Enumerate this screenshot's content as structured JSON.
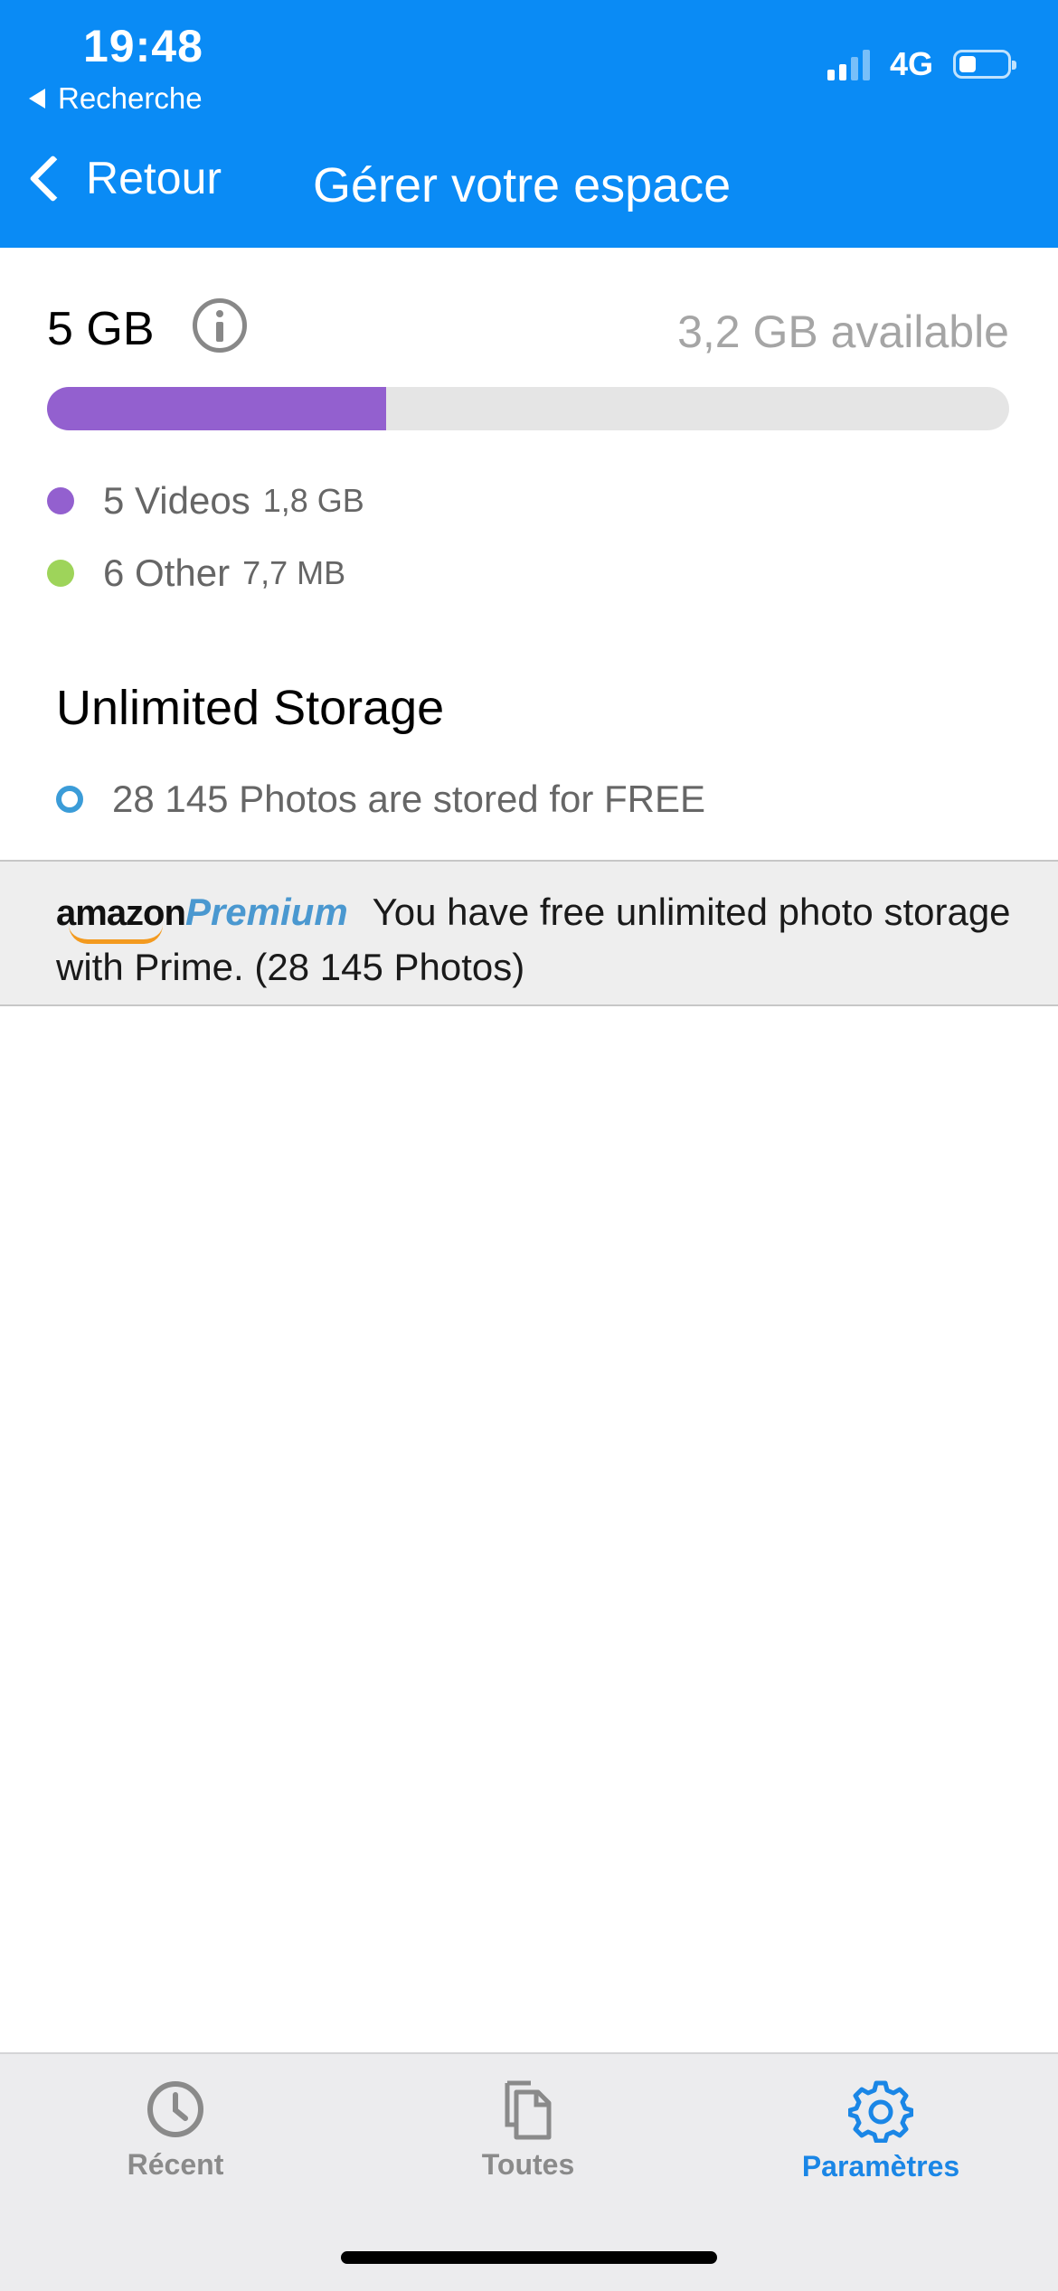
{
  "status_bar": {
    "time": "19:48",
    "back_app": "Recherche",
    "network": "4G"
  },
  "nav": {
    "back_label": "Retour",
    "title": "Gérer votre espace"
  },
  "storage": {
    "total": "5 GB",
    "available": "3,2 GB available",
    "used_fraction": 0.352,
    "used_color": "#9360cf",
    "legend": [
      {
        "name": "5 Videos",
        "size": "1,8 GB",
        "color": "#9360cf"
      },
      {
        "name": "6 Other",
        "size": "7,7 MB",
        "color": "#9ed45a"
      }
    ]
  },
  "unlimited": {
    "title": "Unlimited Storage",
    "photos": "28 145 Photos are stored for FREE"
  },
  "prime_banner": {
    "logo_amazon": "amazon",
    "logo_premium": "Premium",
    "text": "You have free unlimited photo storage with Prime. (28 145 Photos)"
  },
  "tabs": [
    {
      "label": "Récent",
      "icon": "clock-icon",
      "active": false
    },
    {
      "label": "Toutes",
      "icon": "documents-icon",
      "active": false
    },
    {
      "label": "Paramètres",
      "icon": "gear-icon",
      "active": true
    }
  ],
  "colors": {
    "header_blue": "#0a8bf5",
    "tab_active": "#1a86e6"
  }
}
